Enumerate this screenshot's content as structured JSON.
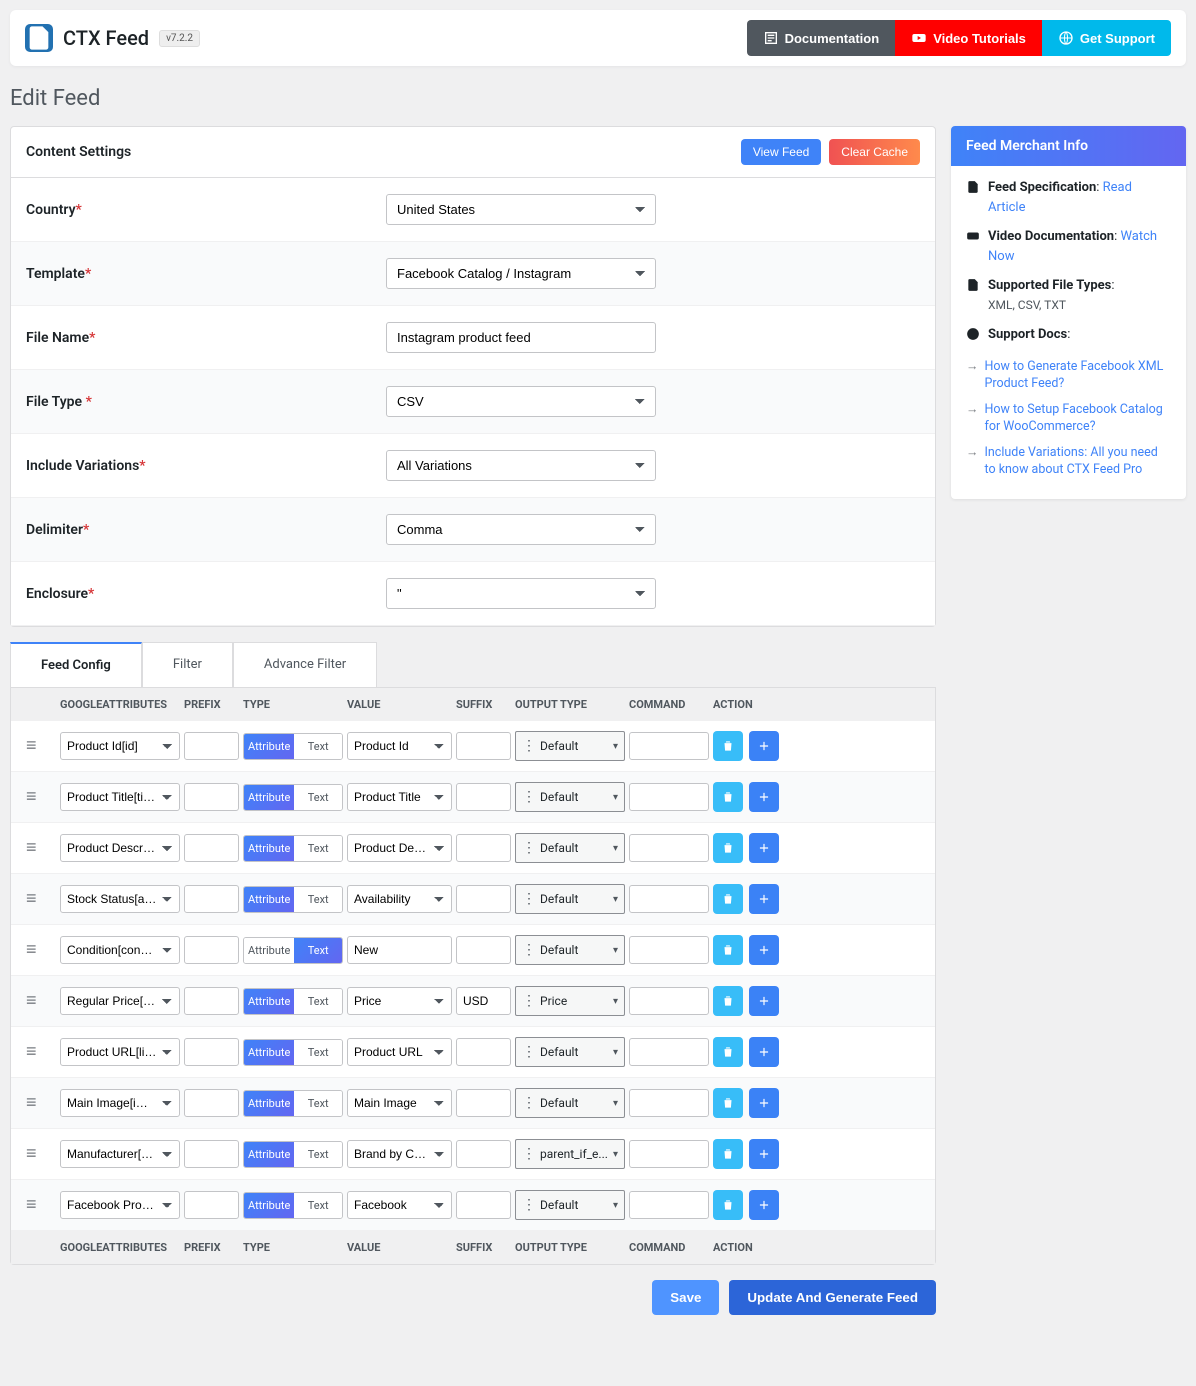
{
  "header": {
    "app_title": "CTX Feed",
    "version": "v7.2.2",
    "doc_btn": "Documentation",
    "video_btn": "Video Tutorials",
    "support_btn": "Get Support"
  },
  "page_title": "Edit Feed",
  "panel": {
    "title": "Content Settings",
    "view_feed": "View Feed",
    "clear_cache": "Clear Cache"
  },
  "form": {
    "country_label": "Country",
    "country_value": "United States",
    "template_label": "Template",
    "template_value": "Facebook Catalog / Instagram",
    "filename_label": "File Name",
    "filename_value": "Instagram product feed",
    "filetype_label": "File Type ",
    "filetype_value": "CSV",
    "variations_label": "Include Variations",
    "variations_value": "All Variations",
    "delimiter_label": "Delimiter",
    "delimiter_value": "Comma",
    "enclosure_label": "Enclosure",
    "enclosure_value": "\""
  },
  "sidebar": {
    "title": "Feed Merchant Info",
    "spec_label": "Feed Specification",
    "spec_link": "Read Article",
    "video_label": "Video Documentation",
    "video_link": "Watch Now",
    "filetypes_label": "Supported File Types",
    "filetypes_value": "XML, CSV, TXT",
    "support_label": "Support Docs",
    "links": [
      "How to Generate Facebook XML Product Feed?",
      "How to Setup Facebook Catalog for WooCommerce?",
      "Include Variations: All you need to know about CTX Feed Pro"
    ]
  },
  "tabs": {
    "feed_config": "Feed Config",
    "filter": "Filter",
    "adv_filter": "Advance Filter"
  },
  "table": {
    "headers": {
      "google_attr": "GOOGLEATTRIBUTES",
      "prefix": "PREFIX",
      "type": "TYPE",
      "value": "VALUE",
      "suffix": "SUFFIX",
      "output_type": "OUTPUT TYPE",
      "command": "COMMAND",
      "action": "ACTION"
    },
    "type_attr": "Attribute",
    "type_text": "Text",
    "rows": [
      {
        "attr": "Product Id[id]",
        "type": "attribute",
        "value": "Product Id",
        "suffix": "",
        "output": "Default"
      },
      {
        "attr": "Product Title[title]",
        "type": "attribute",
        "value": "Product Title",
        "suffix": "",
        "output": "Default"
      },
      {
        "attr": "Product Description",
        "type": "attribute",
        "value": "Product Description",
        "suffix": "",
        "output": "Default"
      },
      {
        "attr": "Stock Status[availability]",
        "type": "attribute",
        "value": "Availability",
        "suffix": "",
        "output": "Default"
      },
      {
        "attr": "Condition[condition]",
        "type": "text",
        "value": "New",
        "suffix": "",
        "output": "Default"
      },
      {
        "attr": "Regular Price[price]",
        "type": "attribute",
        "value": "Price",
        "suffix": "USD",
        "output": "Price"
      },
      {
        "attr": "Product URL[link]",
        "type": "attribute",
        "value": "Product URL",
        "suffix": "",
        "output": "Default"
      },
      {
        "attr": "Main Image[image_link]",
        "type": "attribute",
        "value": "Main Image",
        "suffix": "",
        "output": "Default"
      },
      {
        "attr": "Manufacturer[brand]",
        "type": "attribute",
        "value": "Brand by CTX Feed",
        "suffix": "",
        "output": "parent_if_e..."
      },
      {
        "attr": "Facebook Product Category",
        "type": "attribute",
        "value": "Facebook",
        "suffix": "",
        "output": "Default"
      }
    ]
  },
  "bottom": {
    "save": "Save",
    "update": "Update And Generate Feed"
  }
}
